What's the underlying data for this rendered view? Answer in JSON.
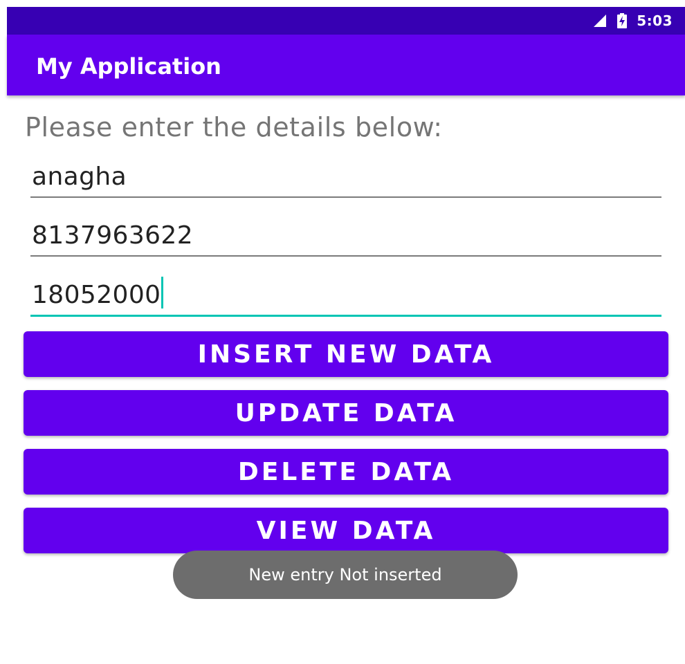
{
  "status_bar": {
    "time": "5:03",
    "icons": [
      "signal-icon",
      "battery-charging-icon"
    ],
    "background": "#3700b3"
  },
  "app_bar": {
    "title": "My Application",
    "background": "#6200ee"
  },
  "form": {
    "prompt": "Please enter the details below:",
    "fields": [
      {
        "value": "anagha",
        "focused": false
      },
      {
        "value": "8137963622",
        "focused": false
      },
      {
        "value": "18052000",
        "focused": true
      }
    ],
    "accent_color": "#00c4b4"
  },
  "buttons": [
    {
      "label": "INSERT NEW DATA"
    },
    {
      "label": "UPDATE DATA"
    },
    {
      "label": "DELETE DATA"
    },
    {
      "label": "VIEW DATA"
    }
  ],
  "toast": {
    "message": "New entry Not inserted"
  }
}
